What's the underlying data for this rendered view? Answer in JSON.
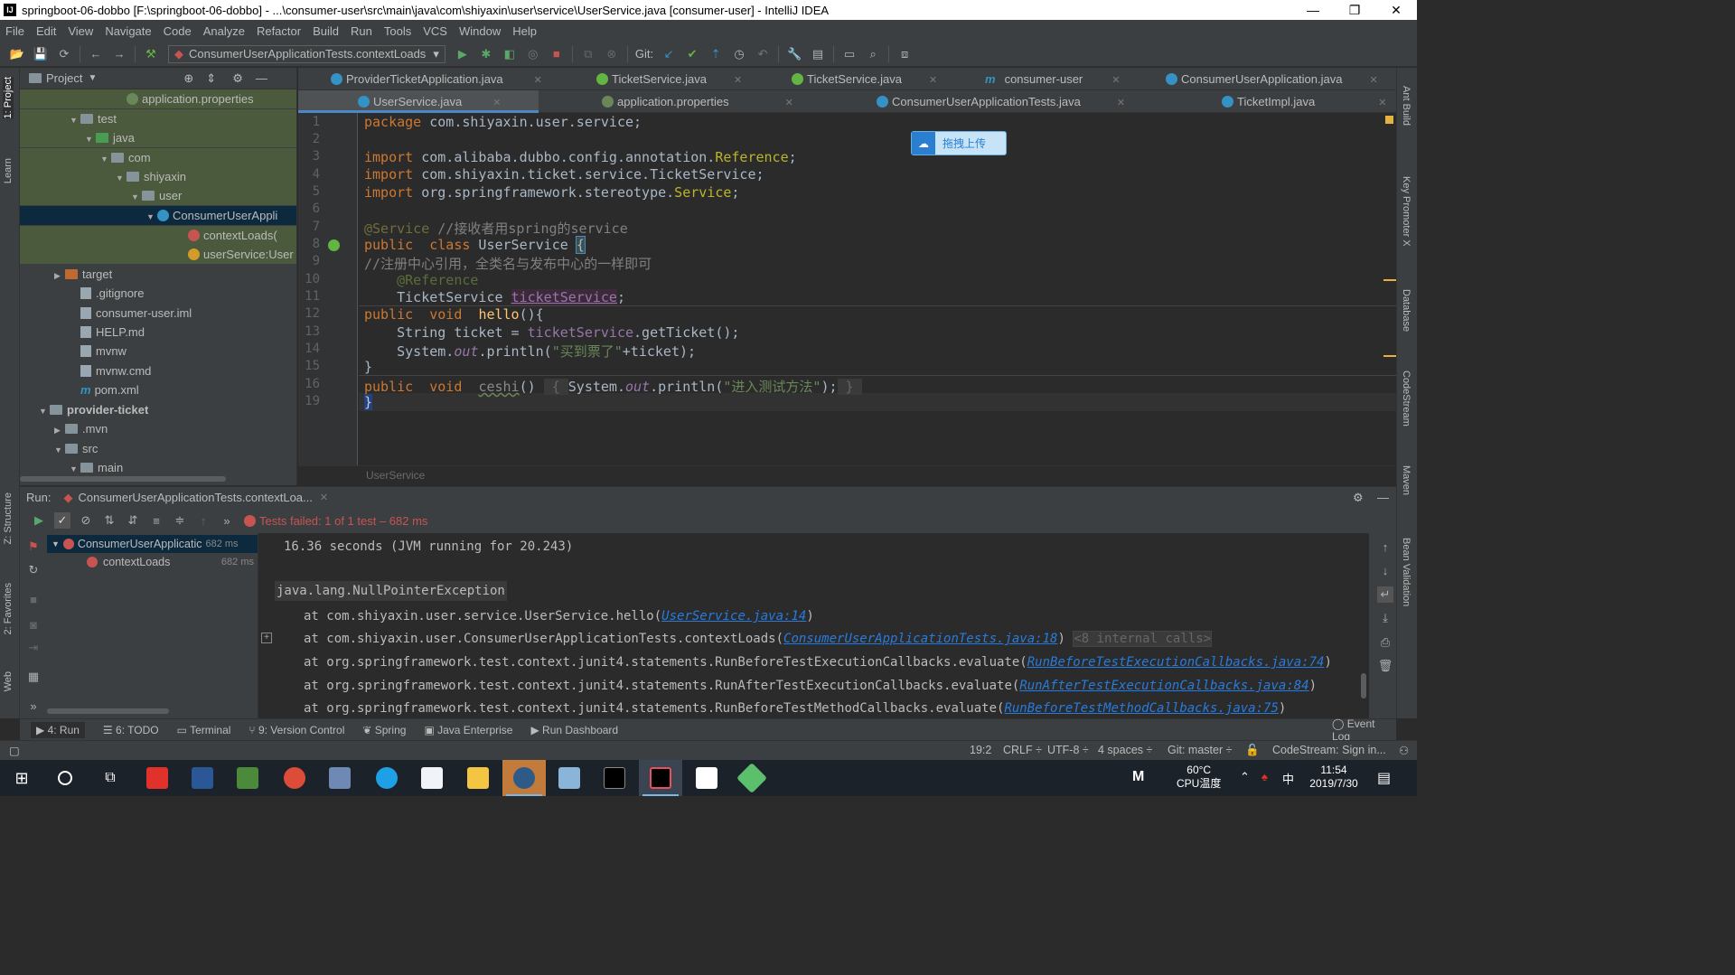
{
  "window": {
    "title": "springboot-06-dobbo [F:\\springboot-06-dobbo] - ...\\consumer-user\\src\\main\\java\\com\\shiyaxin\\user\\service\\UserService.java [consumer-user] - IntelliJ IDEA",
    "app_icon": "IJ"
  },
  "menu": [
    "File",
    "Edit",
    "View",
    "Navigate",
    "Code",
    "Analyze",
    "Refactor",
    "Build",
    "Run",
    "Tools",
    "VCS",
    "Window",
    "Help"
  ],
  "toolbar": {
    "run_config": "ConsumerUserApplicationTests.contextLoads",
    "git_label": "Git:"
  },
  "left_stripe": [
    "1: Project",
    "Learn",
    "Z: Structure",
    "2: Favorites",
    "Web"
  ],
  "right_stripe": [
    "Ant Build",
    "Key Promoter X",
    "Database",
    "CodeStream",
    "Maven",
    "Bean Validation"
  ],
  "project": {
    "header": "Project",
    "rows": [
      {
        "label": "application.properties",
        "icon": "properties-icon",
        "indent": 6,
        "arrow": ""
      },
      {
        "label": "test",
        "icon": "folder",
        "indent": 3,
        "arrow": "▼"
      },
      {
        "label": "java",
        "icon": "folder-test",
        "indent": 4,
        "arrow": "▼"
      },
      {
        "label": "com",
        "icon": "folder",
        "indent": 5,
        "arrow": "▼"
      },
      {
        "label": "shiyaxin",
        "icon": "folder",
        "indent": 6,
        "arrow": "▼"
      },
      {
        "label": "user",
        "icon": "folder",
        "indent": 7,
        "arrow": "▼"
      },
      {
        "label": "ConsumerUserAppli",
        "icon": "class",
        "indent": 8,
        "arrow": "▼"
      },
      {
        "label": "contextLoads(",
        "icon": "method",
        "indent": 10,
        "arrow": ""
      },
      {
        "label": "userService:User",
        "icon": "field",
        "indent": 10,
        "arrow": ""
      },
      {
        "label": "target",
        "icon": "folder-target",
        "indent": 2,
        "arrow": "▶"
      },
      {
        "label": ".gitignore",
        "icon": "file",
        "indent": 3,
        "arrow": ""
      },
      {
        "label": "consumer-user.iml",
        "icon": "file",
        "indent": 3,
        "arrow": ""
      },
      {
        "label": "HELP.md",
        "icon": "file",
        "indent": 3,
        "arrow": ""
      },
      {
        "label": "mvnw",
        "icon": "file",
        "indent": 3,
        "arrow": ""
      },
      {
        "label": "mvnw.cmd",
        "icon": "file",
        "indent": 3,
        "arrow": ""
      },
      {
        "label": "pom.xml",
        "icon": "maven",
        "indent": 3,
        "arrow": ""
      },
      {
        "label": "provider-ticket",
        "icon": "folder-module",
        "indent": 1,
        "arrow": "▼"
      },
      {
        "label": ".mvn",
        "icon": "folder",
        "indent": 2,
        "arrow": "▶"
      },
      {
        "label": "src",
        "icon": "folder",
        "indent": 2,
        "arrow": "▼"
      },
      {
        "label": "main",
        "icon": "folder",
        "indent": 3,
        "arrow": "▼"
      }
    ]
  },
  "tabs_row1": [
    {
      "label": "ProviderTicketApplication.java"
    },
    {
      "label": "TicketService.java"
    },
    {
      "label": "TicketService.java"
    },
    {
      "label": "consumer-user"
    },
    {
      "label": "ConsumerUserApplication.java"
    }
  ],
  "tabs_row2": [
    {
      "label": "UserService.java"
    },
    {
      "label": "application.properties"
    },
    {
      "label": "ConsumerUserApplicationTests.java"
    },
    {
      "label": "TicketImpl.java"
    }
  ],
  "editor": {
    "line_numbers": [
      "1",
      "2",
      "3",
      "4",
      "5",
      "6",
      "7",
      "8",
      "9",
      "10",
      "11",
      "12",
      "13",
      "14",
      "15",
      "16",
      "19"
    ],
    "upload_button": "拖拽上传",
    "breadcrumb": "UserService"
  },
  "run": {
    "label": "Run:",
    "tab": "ConsumerUserApplicationTests.contextLoa...",
    "status": "Tests failed: 1 of 1 test – 682 ms",
    "tree": [
      {
        "label": "ConsumerUserApplicatic",
        "time": "682 ms"
      },
      {
        "label": "contextLoads",
        "time": "682 ms"
      }
    ],
    "console": {
      "line1": "16.36 seconds (JVM running for 20.243)",
      "exception": "java.lang.NullPointerException",
      "frames": [
        {
          "prefix": "at com.shiyaxin.user.service.UserService.hello(",
          "link": "UserService.java:14",
          "suffix": ")",
          "extra": ""
        },
        {
          "prefix": "at com.shiyaxin.user.ConsumerUserApplicationTests.contextLoads(",
          "link": "ConsumerUserApplicationTests.java:18",
          "suffix": ")",
          "extra": "<8 internal calls>"
        },
        {
          "prefix": "at org.springframework.test.context.junit4.statements.RunBeforeTestExecutionCallbacks.evaluate(",
          "link": "RunBeforeTestExecutionCallbacks.java:74",
          "suffix": ")",
          "extra": ""
        },
        {
          "prefix": "at org.springframework.test.context.junit4.statements.RunAfterTestExecutionCallbacks.evaluate(",
          "link": "RunAfterTestExecutionCallbacks.java:84",
          "suffix": ")",
          "extra": ""
        },
        {
          "prefix": "at org.springframework.test.context.junit4.statements.RunBeforeTestMethodCallbacks.evaluate(",
          "link": "RunBeforeTestMethodCallbacks.java:75",
          "suffix": ")",
          "extra": ""
        }
      ]
    }
  },
  "tool_tabs": [
    "4: Run",
    "6: TODO",
    "Terminal",
    "9: Version Control",
    "Spring",
    "Java Enterprise",
    "Run Dashboard"
  ],
  "event_log": "Event Log",
  "status": {
    "position": "19:2",
    "line_sep": "CRLF ÷",
    "encoding": "UTF-8 ÷",
    "indent": "4 spaces ÷",
    "git": "Git: master ÷",
    "codestream": "CodeStream: Sign in..."
  },
  "taskbar": {
    "temp": "60°C",
    "cpu": "CPU温度",
    "ime": "中",
    "time": "11:54",
    "date": "2019/7/30"
  }
}
